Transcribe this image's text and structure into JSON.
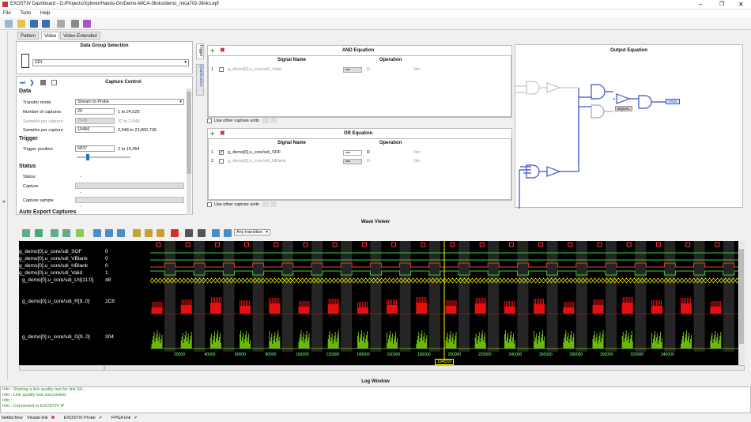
{
  "window": {
    "title": "EXOSTIV Dashboard - D:/Projects/Xplorer/Hands-On/Demo-MICA-3links/demo_mica702-3links.epf"
  },
  "menu": [
    "File",
    "Tools",
    "Help"
  ],
  "tabs": [
    "Pattern",
    "Video",
    "Video-Extended"
  ],
  "data_group": {
    "title": "Data Group Selection",
    "selected": "SDI"
  },
  "capture_control": {
    "title": "Capture Control",
    "data_section": "Data",
    "transfer_mode_label": "Transfer mode",
    "transfer_mode_value": "Stream to Probe",
    "num_captures_label": "Number of captures",
    "num_captures_value": "20",
    "num_captures_range": "1 to 24,528",
    "samples_per_capture_label_1": "Samples per capture",
    "samples_per_capture_value_1": "2048",
    "samples_per_capture_range_1": "32 to 2,048",
    "samples_per_capture_label_2": "Samples per capture",
    "samples_per_capture_value_2": "19456",
    "samples_per_capture_range_2": "2,048 to 23,860,736",
    "trigger_section": "Trigger",
    "trigger_position_label": "Trigger position",
    "trigger_position_value": "5837",
    "trigger_position_range": "2 to 19,454",
    "status_section": "Status",
    "status_label": "Status",
    "status_value": "-",
    "capture_label": "Capture",
    "capture_value": "-",
    "capture_sample_label": "Capture sample",
    "capture_sample_value": "-",
    "auto_export": "Auto Export Captures"
  },
  "side_tabs": [
    "Trigger",
    "Qualification"
  ],
  "and_eq": {
    "title": "AND Equation",
    "col_signal": "Signal Name",
    "col_op": "Operation",
    "rows": [
      {
        "n": "1",
        "signal": "g_demo[0].u_core/sdi_Valid",
        "op": "==",
        "val": "R",
        "fmt": "bin"
      }
    ],
    "use_other": "Use other capture units"
  },
  "or_eq": {
    "title": "OR Equation",
    "col_signal": "Signal Name",
    "col_op": "Operation",
    "rows": [
      {
        "n": "1",
        "signal": "g_demo[0].u_core/sdi_SOF",
        "op": "==",
        "val": "R",
        "fmt": "bin"
      },
      {
        "n": "2",
        "signal": "g_demo[0].u_core/sdi_HBlank",
        "op": "==",
        "val": "R",
        "fmt": "bin"
      }
    ],
    "use_other": "Use other capture units"
  },
  "output_eq": {
    "title": "Output Equation",
    "equal_label": "EQUAL",
    "trig_label": "TRIG"
  },
  "wave_viewer": {
    "title": "Wave Viewer",
    "transition": "Any transition",
    "signals": [
      {
        "name": "g_demo[0].u_core/sdi_SOF",
        "value": "0"
      },
      {
        "name": "g_demo[0].u_core/sdi_VBlank",
        "value": "0"
      },
      {
        "name": "g_demo[0].u_core/sdi_HBlank",
        "value": "0"
      },
      {
        "name": "g_demo[0].u_core/sdi_Valid",
        "value": "1"
      },
      {
        "name": "g_demo[0].u_core/sdi_LN[11:0]",
        "value": "48"
      },
      {
        "name": "g_demo[0].u_core/sdi_R[9..0]",
        "value": "2C8"
      },
      {
        "name": "g_demo[0].u_core/sdi_G[9..0]",
        "value": "304"
      }
    ],
    "ticks": [
      "20000",
      "40000",
      "60000",
      "80000",
      "100000",
      "120000",
      "140000",
      "160000",
      "180000",
      "200000",
      "220000",
      "240000",
      "260000",
      "280000",
      "300000",
      "320000",
      "340000"
    ],
    "cursor": "194559"
  },
  "log": {
    "title": "Log Window",
    "lines": [
      "Info : Starting a link quality test for link S4...",
      "Info : Link quality test succeeded.",
      "Info :",
      "Info : Connected to EXOSTIV IP"
    ]
  },
  "status": [
    "Netlist flow",
    "Vivado link",
    "EXOSTIV Probe",
    "FPGA link"
  ]
}
